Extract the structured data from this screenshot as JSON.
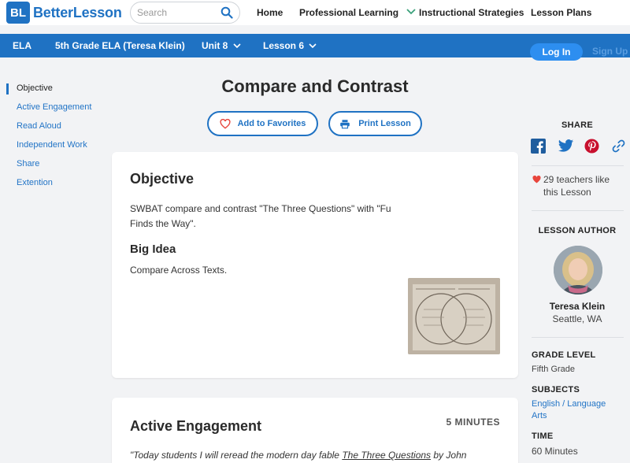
{
  "brand": {
    "badge": "BL",
    "name": "BetterLesson"
  },
  "search": {
    "placeholder": "Search"
  },
  "topnav": {
    "home": "Home",
    "professional_learning": "Professional Learning",
    "instructional_strategies": "Instructional Strategies",
    "lesson_plans": "Lesson Plans"
  },
  "breadcrumb": {
    "subject": "ELA",
    "course": "5th Grade ELA (Teresa Klein)",
    "unit": "Unit 8",
    "lesson": "Lesson 6"
  },
  "auth": {
    "login": "Log In",
    "signup": "Sign Up"
  },
  "sidebar": {
    "items": [
      {
        "label": "Objective",
        "active": true
      },
      {
        "label": "Active Engagement",
        "active": false
      },
      {
        "label": "Read Aloud",
        "active": false
      },
      {
        "label": "Independent Work",
        "active": false
      },
      {
        "label": "Share",
        "active": false
      },
      {
        "label": "Extention",
        "active": false
      }
    ]
  },
  "main": {
    "title": "Compare and Contrast",
    "add_favorites": "Add to Favorites",
    "print_lesson": "Print Lesson",
    "objective": {
      "heading": "Objective",
      "text_line1": "SWBAT compare and contrast \"The Three Questions\"  with \"Fu",
      "text_line2": "Finds the Way\".",
      "big_idea_heading": "Big Idea",
      "big_idea_text": "Compare Across Texts."
    },
    "active_engagement": {
      "heading": "Active Engagement",
      "minutes": "5 MINUTES",
      "quote_start": "\"Today students I will reread the modern day fable ",
      "quote_link": "The Three Questions",
      "quote_end": "  by John"
    }
  },
  "right": {
    "share_heading": "SHARE",
    "likes_line1": "29 teachers like",
    "likes_line2": "this Lesson",
    "author_heading": "LESSON AUTHOR",
    "author_name": "Teresa Klein",
    "author_location": "Seattle, WA",
    "grade_heading": "GRADE LEVEL",
    "grade_value": "Fifth Grade",
    "subjects_heading": "SUBJECTS",
    "subjects_line1": "English / Language",
    "subjects_line2": "Arts",
    "time_heading": "TIME",
    "time_value": "60 Minutes"
  },
  "colors": {
    "brand_blue": "#1f72c3",
    "link_blue": "#2274c6",
    "heart_red": "#e8453c"
  }
}
